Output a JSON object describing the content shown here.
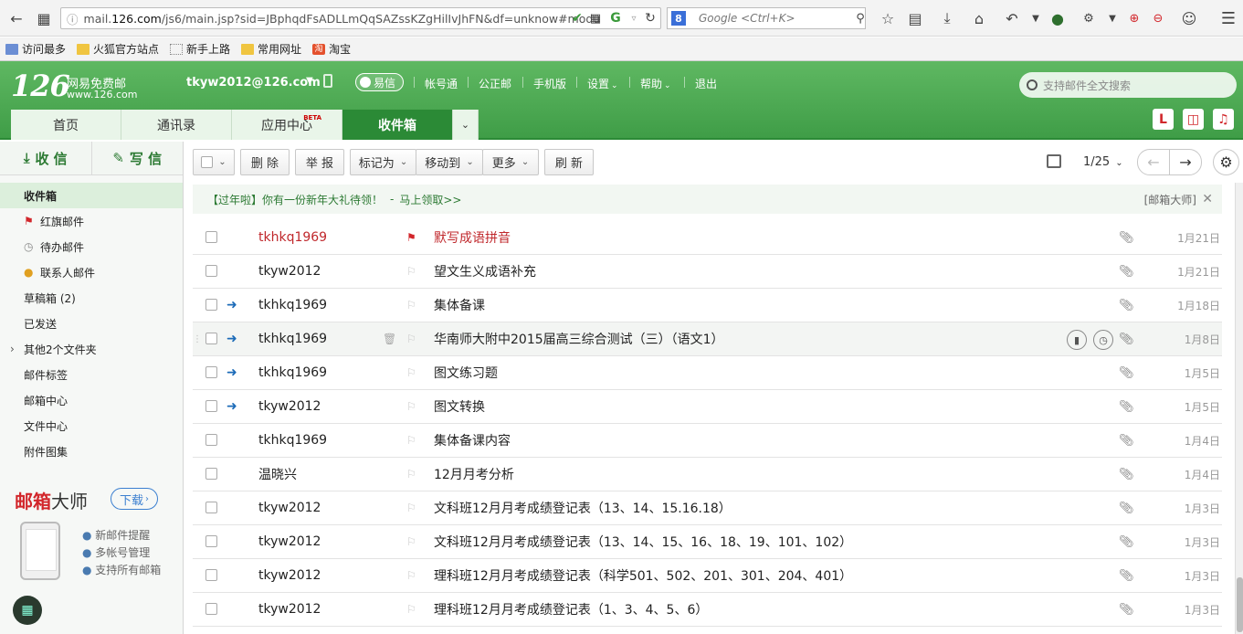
{
  "browser": {
    "url_prefix": "mail.",
    "url_domain": "126.com",
    "url_rest": "/js6/main.jsp?sid=JBphqdFsADLLmQqSAZssKZgHilIvJhFN&df=unknow#modu",
    "search_placeholder": "Google <Ctrl+K>"
  },
  "bookmarks": [
    {
      "label": "访问最多"
    },
    {
      "label": "火狐官方站点"
    },
    {
      "label": "新手上路"
    },
    {
      "label": "常用网址"
    },
    {
      "label": "淘宝"
    }
  ],
  "header": {
    "logo_num": "126",
    "logo_cn": "网易免费邮",
    "logo_url": "www.126.com",
    "account": "tkyw2012@126.com",
    "yixin": "易信",
    "links": [
      "帐号通",
      "公正邮",
      "手机版",
      "设置",
      "帮助",
      "退出"
    ],
    "search_placeholder": "支持邮件全文搜索"
  },
  "nav": {
    "tabs": [
      "首页",
      "通讯录",
      "应用中心",
      "收件箱"
    ],
    "beta": "BETA"
  },
  "sidebar": {
    "receive": "收 信",
    "compose": "写 信",
    "folders": [
      {
        "label": "收件箱"
      },
      {
        "label": "红旗邮件"
      },
      {
        "label": "待办邮件"
      },
      {
        "label": "联系人邮件"
      },
      {
        "label": "草稿箱 (2)"
      },
      {
        "label": "已发送"
      },
      {
        "label": "其他2个文件夹"
      },
      {
        "label": "邮件标签"
      },
      {
        "label": "邮箱中心"
      },
      {
        "label": "文件中心"
      },
      {
        "label": "附件图集"
      }
    ],
    "promo": {
      "title_a": "邮箱",
      "title_b": "大师",
      "download": "下载",
      "features": [
        "新邮件提醒",
        "多帐号管理",
        "支持所有邮箱"
      ]
    }
  },
  "toolbar": {
    "delete": "删 除",
    "report": "举 报",
    "mark_as": "标记为",
    "move_to": "移动到",
    "more": "更多",
    "refresh": "刷 新",
    "pager": "1/25"
  },
  "notice": {
    "text": "【过年啦】你有一份新年大礼待领！",
    "dash": "-",
    "link": "马上领取>>",
    "source": "[邮箱大师]"
  },
  "mails": [
    {
      "from": "tkhkq1969",
      "subject": "默写成语拼音",
      "date": "1月21日"
    },
    {
      "from": "tkyw2012",
      "subject": "望文生义成语补充",
      "date": "1月21日"
    },
    {
      "from": "tkhkq1969",
      "subject": "集体备课",
      "date": "1月18日"
    },
    {
      "from": "tkhkq1969",
      "subject": "华南师大附中2015届高三综合测试（三）（语文1）",
      "date": "1月8日"
    },
    {
      "from": "tkhkq1969",
      "subject": "图文练习题",
      "date": "1月5日"
    },
    {
      "from": "tkyw2012",
      "subject": "图文转换",
      "date": "1月5日"
    },
    {
      "from": "tkhkq1969",
      "subject": "集体备课内容",
      "date": "1月4日"
    },
    {
      "from": "温晓兴",
      "subject": "12月月考分析",
      "date": "1月4日"
    },
    {
      "from": "tkyw2012",
      "subject": "文科班12月月考成绩登记表（13、14、15.16.18）",
      "date": "1月3日"
    },
    {
      "from": "tkyw2012",
      "subject": "文科班12月月考成绩登记表（13、14、15、16、18、19、101、102）",
      "date": "1月3日"
    },
    {
      "from": "tkyw2012",
      "subject": "理科班12月月考成绩登记表（科学501、502、201、301、204、401）",
      "date": "1月3日"
    },
    {
      "from": "tkyw2012",
      "subject": "理科班12月月考成绩登记表（1、3、4、5、6）",
      "date": "1月3日"
    }
  ]
}
